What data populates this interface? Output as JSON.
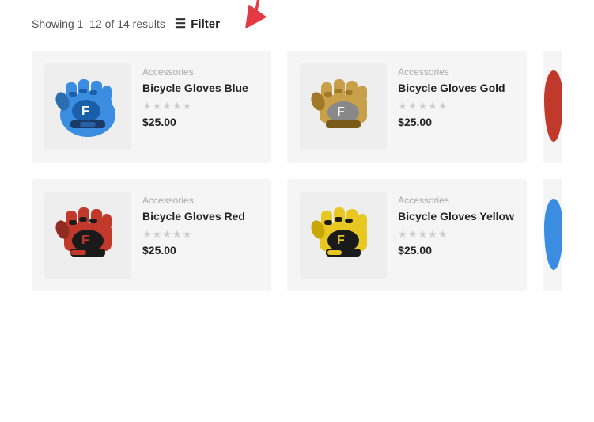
{
  "topBar": {
    "resultsText": "Showing 1–12 of 14 results",
    "filterLabel": "Filter"
  },
  "rows": [
    {
      "cards": [
        {
          "category": "Accessories",
          "name": "Bicycle Gloves Blue",
          "price": "$25.00",
          "color": "blue",
          "stars": [
            0,
            0,
            0,
            0,
            0
          ]
        },
        {
          "category": "Accessories",
          "name": "Bicycle Gloves Gold",
          "price": "$25.00",
          "color": "gold",
          "stars": [
            0,
            0,
            0,
            0,
            0
          ]
        }
      ],
      "partialColor": "red-accent"
    },
    {
      "cards": [
        {
          "category": "Accessories",
          "name": "Bicycle Gloves Red",
          "price": "$25.00",
          "color": "red",
          "stars": [
            0,
            0,
            0,
            0,
            0
          ]
        },
        {
          "category": "Accessories",
          "name": "Bicycle Gloves Yellow",
          "price": "$25.00",
          "color": "yellow",
          "stars": [
            0,
            0,
            0,
            0,
            0
          ]
        }
      ],
      "partialColor": "blue-accent"
    }
  ],
  "icons": {
    "filter": "☰",
    "star": "★",
    "starEmpty": "★"
  }
}
